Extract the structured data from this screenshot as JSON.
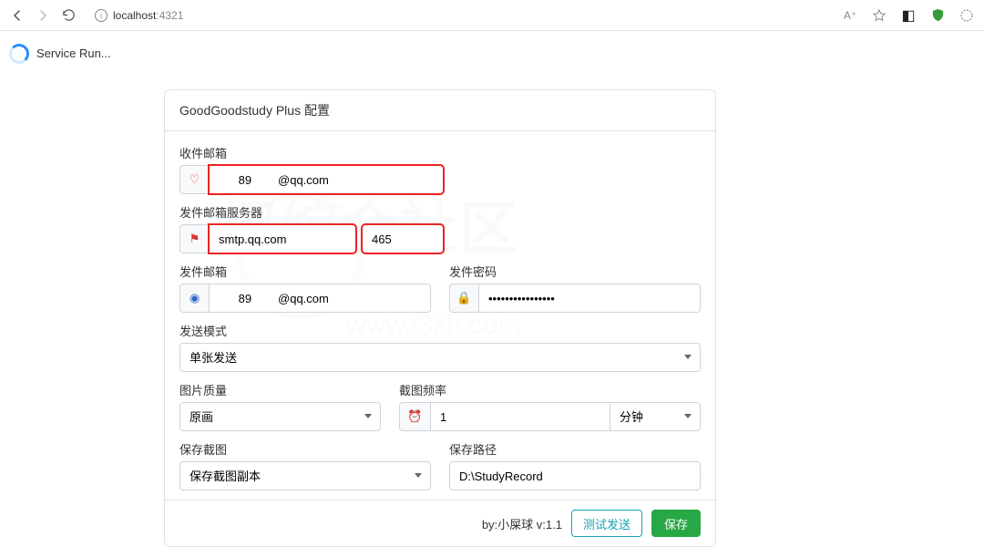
{
  "browser": {
    "host": "localhost",
    "port": ":4321",
    "text_zoom": "A⁺"
  },
  "left": {
    "service_text": "Service Run..."
  },
  "card": {
    "title": "GoodGoodstudy Plus 配置",
    "recv_label": "收件邮箱",
    "recv_value": "      89        @qq.com",
    "smtp_label": "发件邮箱服务器",
    "smtp_host": "smtp.qq.com",
    "smtp_port": "465",
    "send_label": "发件邮箱",
    "send_value": "      89        @qq.com",
    "pwd_label": "发件密码",
    "pwd_value": "••••••••••••••••",
    "mode_label": "发送模式",
    "mode_value": "单张发送",
    "quality_label": "图片质量",
    "quality_value": "原画",
    "freq_label": "截图频率",
    "freq_value": "1",
    "freq_unit": "分钟",
    "save_label": "保存截图",
    "save_value": "保存截图副本",
    "path_label": "保存路径",
    "path_value": "D:\\StudyRecord",
    "by_text": "by:小屎球 v:1.1",
    "test_btn": "测试发送",
    "save_btn": "保存"
  },
  "icons": {
    "heart": "♡",
    "flag": "⚑",
    "camera": "◉",
    "lock": "🔒",
    "clock": "⏰"
  }
}
